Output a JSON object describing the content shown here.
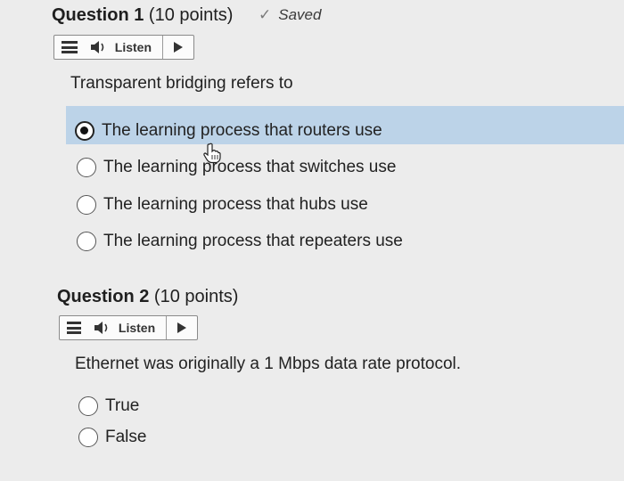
{
  "question1": {
    "title": "Question 1",
    "points": "(10 points)",
    "saved_label": "Saved",
    "check_icon": "✓",
    "listen_label": "Listen",
    "prompt": "Transparent bridging refers to",
    "options": [
      {
        "label": "The learning process that routers use",
        "selected": true
      },
      {
        "label": "The learning process that switches use",
        "selected": false
      },
      {
        "label": "The learning process that hubs use",
        "selected": false
      },
      {
        "label": "The learning process that repeaters use",
        "selected": false
      }
    ],
    "highlight_color": "#bcd3e8"
  },
  "question2": {
    "title": "Question 2",
    "points": "(10 points)",
    "listen_label": "Listen",
    "prompt": "Ethernet was originally a 1 Mbps data rate protocol.",
    "options": [
      {
        "label": "True",
        "selected": false
      },
      {
        "label": "False",
        "selected": false
      }
    ]
  }
}
